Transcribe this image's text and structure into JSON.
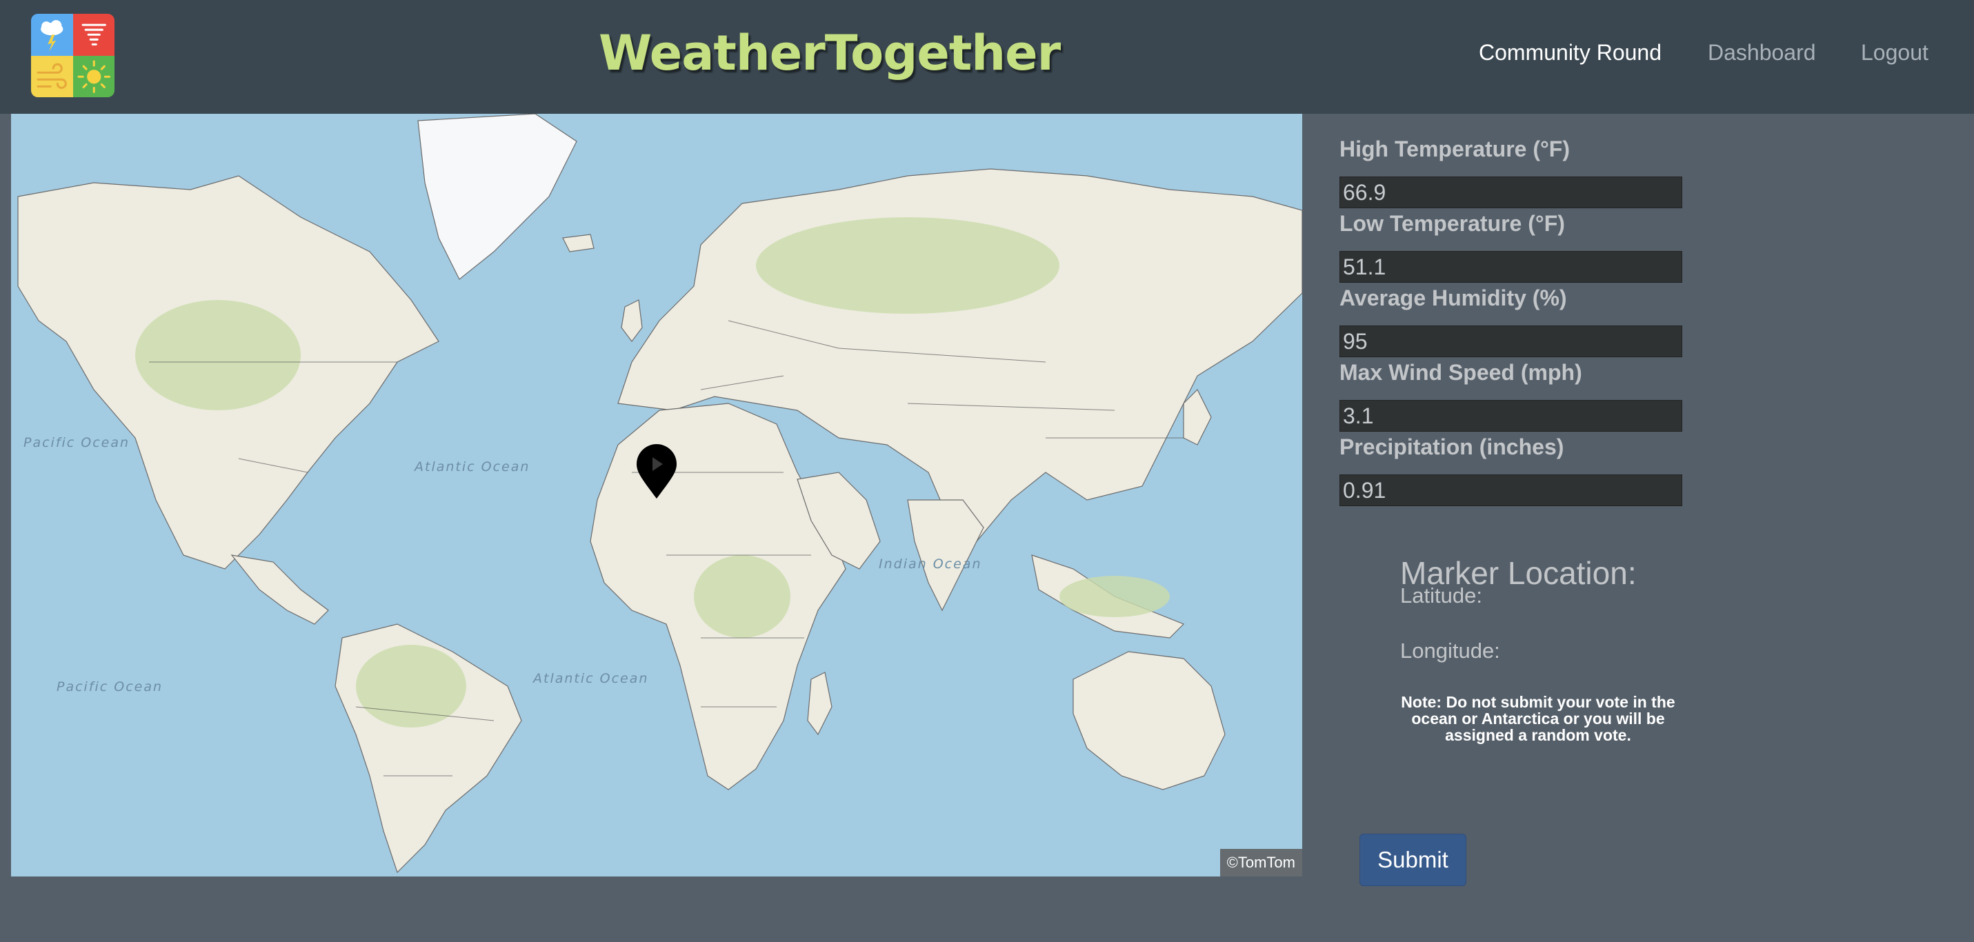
{
  "header": {
    "brand": "WeatherTogether",
    "nav": [
      "Community Round",
      "Dashboard",
      "Logout"
    ]
  },
  "logo": {
    "tiles": [
      "storm-icon",
      "tornado-icon",
      "wind-icon",
      "sun-icon"
    ],
    "colors": [
      "#5aabf0",
      "#e9473e",
      "#f5d44e",
      "#59b64f"
    ]
  },
  "map": {
    "attribution": "©TomTom",
    "ocean_labels": [
      "Pacific Ocean",
      "Atlantic Ocean",
      "Indian Ocean",
      "Atlantic Ocean",
      "Pacific Ocean"
    ]
  },
  "form": {
    "fields": [
      {
        "label": "High Temperature (°F)",
        "value": "66.9"
      },
      {
        "label": "Low Temperature (°F)",
        "value": "51.1"
      },
      {
        "label": "Average Humidity (%)",
        "value": "95"
      },
      {
        "label": "Max Wind Speed (mph)",
        "value": "3.1"
      },
      {
        "label": "Precipitation (inches)",
        "value": "0.91"
      }
    ],
    "marker_title": "Marker Location:",
    "latitude_label": "Latitude:",
    "longitude_label": "Longitude:",
    "note": "Note: Do not submit your vote in the ocean or Antarctica or you will be assigned a random vote.",
    "submit": "Submit"
  },
  "colors": {
    "navbar": "#3a4750",
    "background": "#555f69",
    "brand": "#c5e082",
    "ocean": "#a3cbe2",
    "land": "#eeece1",
    "vegetation": "#cbdcab",
    "submit": "#375a8c"
  }
}
